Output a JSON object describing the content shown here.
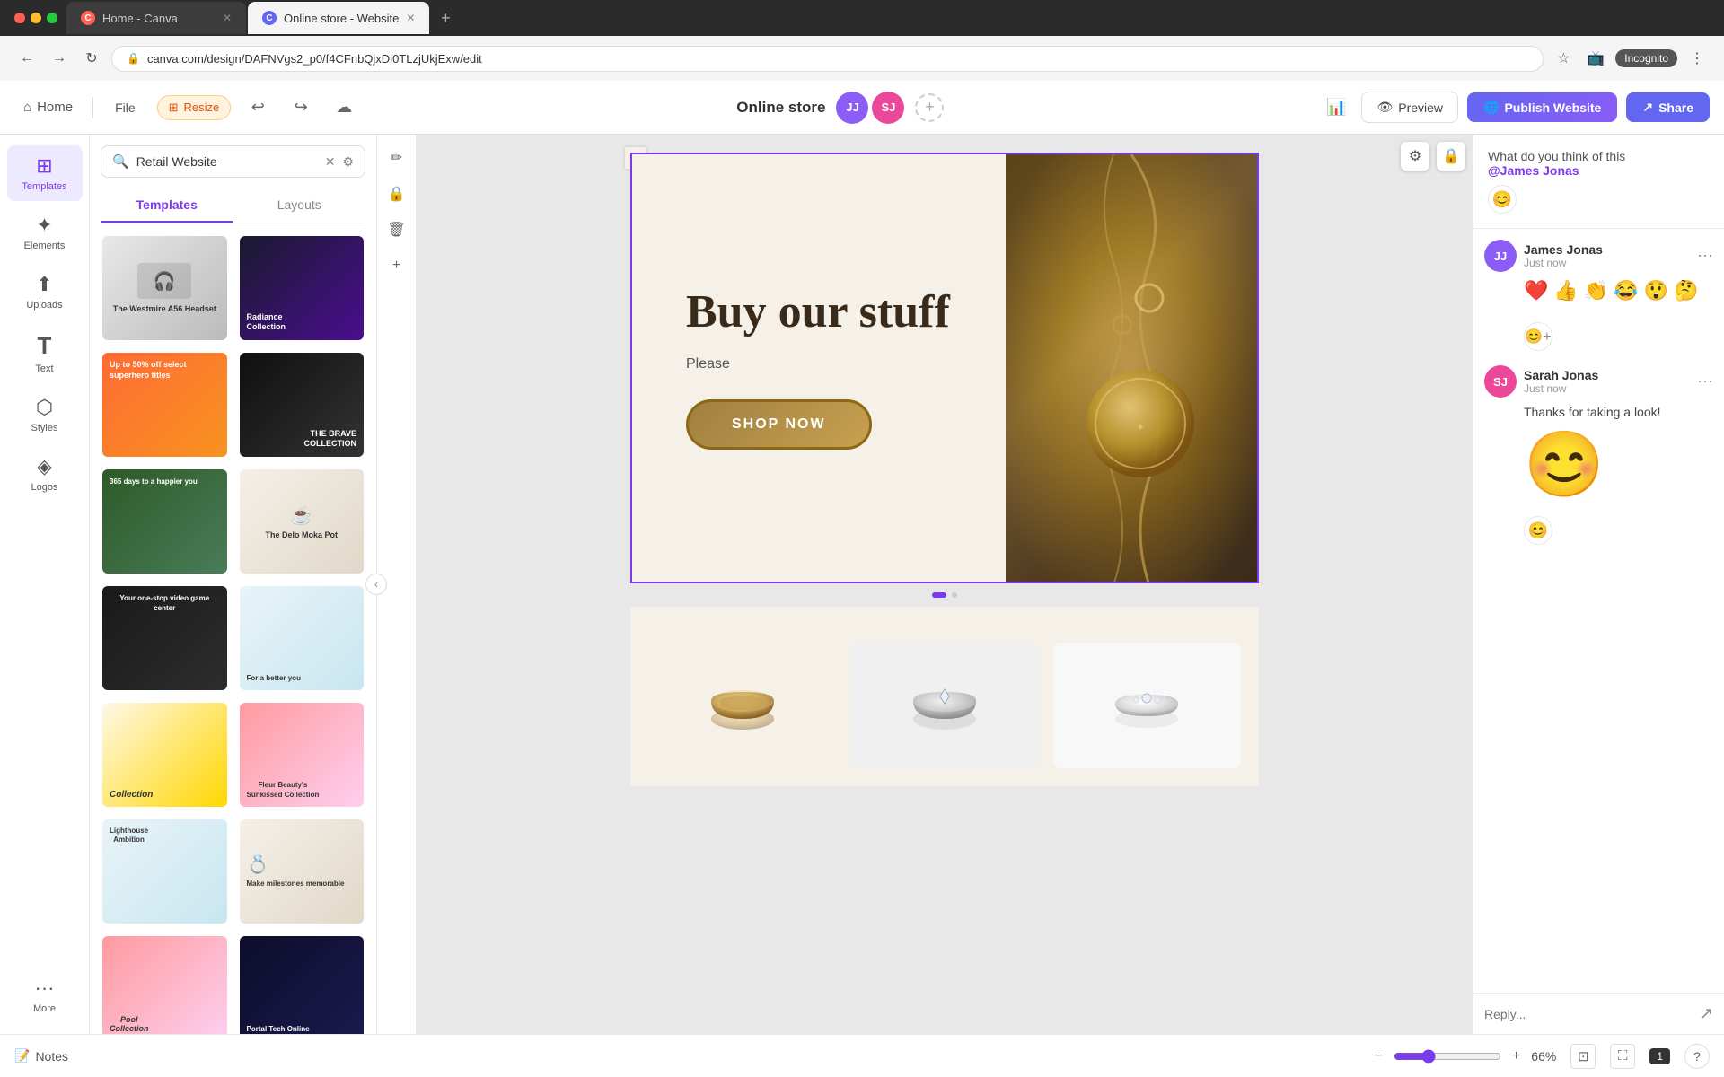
{
  "browser": {
    "tabs": [
      {
        "id": "tab1",
        "title": "Home - Canva",
        "favicon_color": "#ff5f57",
        "active": false
      },
      {
        "id": "tab2",
        "title": "Online store - Website",
        "favicon_color": "#6366f1",
        "active": true
      }
    ],
    "new_tab_label": "+",
    "address": "canva.com/design/DAFNVgs2_p0/f4CFnbQjxDi0TLzjUkjExw/edit",
    "lock_icon": "🔒",
    "incognito_label": "Incognito",
    "nav": {
      "back": "←",
      "forward": "→",
      "refresh": "↻"
    }
  },
  "topbar": {
    "home_label": "Home",
    "file_label": "File",
    "resize_label": "Resize",
    "undo_icon": "↩",
    "redo_icon": "↪",
    "cloud_icon": "☁",
    "doc_title": "Online store",
    "preview_label": "Preview",
    "publish_label": "Publish Website",
    "share_label": "Share",
    "collab": [
      {
        "initials": "JJ",
        "color": "#8b5cf6"
      },
      {
        "initials": "SJ",
        "color": "#ec4899"
      }
    ]
  },
  "sidebar": {
    "items": [
      {
        "id": "templates",
        "label": "Templates",
        "icon": "⊞",
        "active": true
      },
      {
        "id": "elements",
        "label": "Elements",
        "icon": "✦",
        "active": false
      },
      {
        "id": "uploads",
        "label": "Uploads",
        "icon": "⬆",
        "active": false
      },
      {
        "id": "text",
        "label": "Text",
        "icon": "T",
        "active": false
      },
      {
        "id": "styles",
        "label": "Styles",
        "icon": "⬡",
        "active": false
      },
      {
        "id": "logos",
        "label": "Logos",
        "icon": "◈",
        "active": false
      },
      {
        "id": "more",
        "label": "More",
        "icon": "···",
        "active": false
      }
    ]
  },
  "panel": {
    "search_placeholder": "Retail Website",
    "search_value": "Retail Website",
    "tabs": [
      {
        "id": "templates",
        "label": "Templates",
        "active": true
      },
      {
        "id": "layouts",
        "label": "Layouts",
        "active": false
      }
    ],
    "template_cards": [
      {
        "id": 1,
        "label": "The Westmire A56 Headset",
        "color_class": "tc-color-1"
      },
      {
        "id": 2,
        "label": "Radiance Collection",
        "color_class": "tc-color-2"
      },
      {
        "id": 3,
        "label": "Up to 50% off select superhero titles",
        "color_class": "tc-color-3"
      },
      {
        "id": 4,
        "label": "The Brave Collection",
        "color_class": "tc-color-5"
      },
      {
        "id": 5,
        "label": "365 days to a happier you",
        "color_class": "tc-color-4"
      },
      {
        "id": 6,
        "label": "The Delo Moka Pot",
        "color_class": "tc-color-8"
      },
      {
        "id": 7,
        "label": "Your one-stop video game center",
        "color_class": "tc-color-7"
      },
      {
        "id": 8,
        "label": "For a better you",
        "color_class": "tc-color-9"
      },
      {
        "id": 9,
        "label": "Collection",
        "color_class": "tc-color-10"
      },
      {
        "id": 10,
        "label": "Fleur Beauty's Sunkissed Collection",
        "color_class": "tc-color-11"
      },
      {
        "id": 11,
        "label": "Lighthouse Ambition",
        "color_class": "tc-color-9"
      },
      {
        "id": 12,
        "label": "Make milestones memorable",
        "color_class": "tc-color-8"
      },
      {
        "id": 13,
        "label": "Pool Collection",
        "color_class": "tc-color-11"
      },
      {
        "id": 14,
        "label": "Portal Tech Online",
        "color_class": "tc-color-12"
      }
    ]
  },
  "canvas": {
    "design_headline": "Buy our stuff",
    "design_subtext": "Please",
    "shop_btn_label": "SHOP NOW",
    "zoom_level": "66%",
    "page_number": "1",
    "notes_label": "Notes"
  },
  "comments": {
    "header_text": "What do you think of this",
    "mention": "@James Jonas",
    "comment_items": [
      {
        "id": "c1",
        "author": "James Jonas",
        "initials": "JJ",
        "avatar_color": "#8b5cf6",
        "time": "Just now",
        "reactions": [
          "❤️",
          "👍",
          "👏",
          "😂",
          "😲",
          "🤔"
        ]
      },
      {
        "id": "c2",
        "author": "Sarah Jonas",
        "initials": "SJ",
        "avatar_color": "#ec4899",
        "time": "Just now",
        "body": "Thanks for taking a look!",
        "has_emoji": true
      }
    ],
    "reply_placeholder": "Reply..."
  }
}
